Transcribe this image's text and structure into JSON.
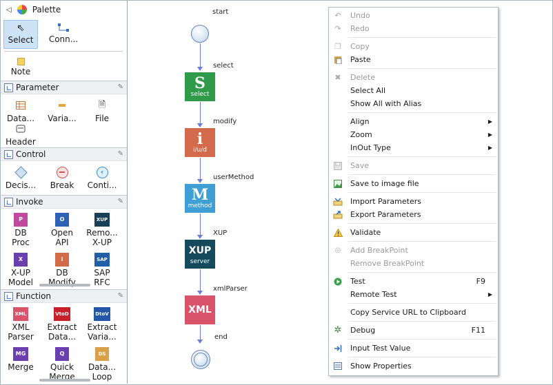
{
  "palette": {
    "title": "Palette",
    "tools": [
      {
        "label": "Select",
        "icon": "cursor-arrow-icon",
        "selected": true
      },
      {
        "label": "Conn...",
        "icon": "connection-icon",
        "selected": false
      }
    ],
    "note_label": "Note",
    "drawers": [
      {
        "title": "Parameter",
        "items": [
          {
            "label": "Data...",
            "icon": "data-table-icon"
          },
          {
            "label": "Varia...",
            "icon": "variable-icon"
          },
          {
            "label": "File",
            "icon": "file-icon"
          },
          {
            "label": "Header",
            "icon": "header-icon"
          }
        ]
      },
      {
        "title": "Control",
        "items": [
          {
            "label": "Decis...",
            "icon": "decision-diamond-icon"
          },
          {
            "label": "Break",
            "icon": "break-icon"
          },
          {
            "label": "Conti...",
            "icon": "continue-icon"
          }
        ]
      },
      {
        "title": "Invoke",
        "items": [
          {
            "label": "DB",
            "label2": "Proc",
            "icon": "db-proc-icon",
            "badge": "P"
          },
          {
            "label": "Open",
            "label2": "API",
            "icon": "open-api-icon",
            "badge": "O"
          },
          {
            "label": "Remo...",
            "label2": "X-UP",
            "icon": "remote-xup-icon",
            "badge": "XUP"
          },
          {
            "label": "X-UP",
            "label2": "Model",
            "icon": "xup-model-icon",
            "badge": "X"
          },
          {
            "label": "DB",
            "label2": "Modify",
            "icon": "db-modify-icon",
            "badge": "i"
          },
          {
            "label": "SAP",
            "label2": "RFC",
            "icon": "sap-rfc-icon",
            "badge": "SAP"
          }
        ]
      },
      {
        "title": "Function",
        "items": [
          {
            "label": "XML",
            "label2": "Parser",
            "icon": "xml-parser-icon",
            "badge": "XML"
          },
          {
            "label": "Extract",
            "label2": "Data...",
            "icon": "extract-data-icon",
            "badge": "VtoD"
          },
          {
            "label": "Extract",
            "label2": "Varia...",
            "icon": "extract-variable-icon",
            "badge": "DtoV"
          },
          {
            "label": "Merge",
            "icon": "merge-icon",
            "badge": "MG"
          },
          {
            "label": "Quick",
            "label2": "Merge",
            "icon": "quick-merge-icon",
            "badge": "Q"
          },
          {
            "label": "Data...",
            "label2": "Loop",
            "icon": "data-loop-icon",
            "badge": "DS"
          }
        ]
      }
    ]
  },
  "flow": {
    "nodes": [
      {
        "id": "start",
        "label": "start",
        "kind": "start-circle"
      },
      {
        "id": "select",
        "label": "select",
        "kind": "box",
        "big": "S",
        "small": "select",
        "color": "#2e9a4a"
      },
      {
        "id": "modify",
        "label": "modify",
        "kind": "box",
        "big": "i",
        "small": "i/u/d",
        "color": "#d36a4b"
      },
      {
        "id": "userMethod",
        "label": "userMethod",
        "kind": "box",
        "big": "M",
        "small": "method",
        "color": "#3f9fd4"
      },
      {
        "id": "xup",
        "label": "XUP",
        "kind": "box",
        "big": "XUP",
        "small": "server",
        "color": "#144a5c"
      },
      {
        "id": "xmlParser",
        "label": "xmlParser",
        "kind": "box",
        "big": "XML",
        "small": "",
        "color": "#d9536b"
      },
      {
        "id": "end",
        "label": "end",
        "kind": "end-circle"
      }
    ]
  },
  "context_menu": {
    "items": [
      {
        "label": "Undo",
        "icon": "undo-icon",
        "disabled": true
      },
      {
        "label": "Redo",
        "icon": "redo-icon",
        "disabled": true
      },
      {
        "separator": true
      },
      {
        "label": "Copy",
        "icon": "copy-icon",
        "disabled": true
      },
      {
        "label": "Paste",
        "icon": "paste-icon",
        "disabled": false
      },
      {
        "separator": true
      },
      {
        "label": "Delete",
        "icon": "delete-icon",
        "disabled": true
      },
      {
        "label": "Select All",
        "icon": "",
        "disabled": false
      },
      {
        "label": "Show All with Alias",
        "icon": "",
        "disabled": false
      },
      {
        "separator": true
      },
      {
        "label": "Align",
        "icon": "",
        "disabled": false,
        "submenu": true
      },
      {
        "label": "Zoom",
        "icon": "",
        "disabled": false,
        "submenu": true
      },
      {
        "label": "InOut Type",
        "icon": "",
        "disabled": false,
        "submenu": true
      },
      {
        "separator": true
      },
      {
        "label": "Save",
        "icon": "save-icon",
        "disabled": true
      },
      {
        "separator": true
      },
      {
        "label": "Save to image file",
        "icon": "image-icon",
        "disabled": false
      },
      {
        "separator": true
      },
      {
        "label": "Import Parameters",
        "icon": "import-icon",
        "disabled": false
      },
      {
        "label": "Export Parameters",
        "icon": "export-icon",
        "disabled": false
      },
      {
        "separator": true
      },
      {
        "label": "Validate",
        "icon": "warning-icon",
        "disabled": false
      },
      {
        "separator": true
      },
      {
        "label": "Add BreakPoint",
        "icon": "breakpoint-icon",
        "disabled": true
      },
      {
        "label": "Remove BreakPoint",
        "icon": "",
        "disabled": true
      },
      {
        "separator": true
      },
      {
        "label": "Test",
        "icon": "run-icon",
        "disabled": false,
        "accel": "F9"
      },
      {
        "label": "Remote Test",
        "icon": "",
        "disabled": false,
        "submenu": true
      },
      {
        "separator": true
      },
      {
        "label": "Copy Service URL to Clipboard",
        "icon": "",
        "disabled": false
      },
      {
        "separator": true
      },
      {
        "label": "Debug",
        "icon": "debug-icon",
        "disabled": false,
        "accel": "F11"
      },
      {
        "separator": true
      },
      {
        "label": "Input Test Value",
        "icon": "input-icon",
        "disabled": false
      },
      {
        "separator": true
      },
      {
        "label": "Show Properties",
        "icon": "properties-icon",
        "disabled": false
      }
    ]
  }
}
